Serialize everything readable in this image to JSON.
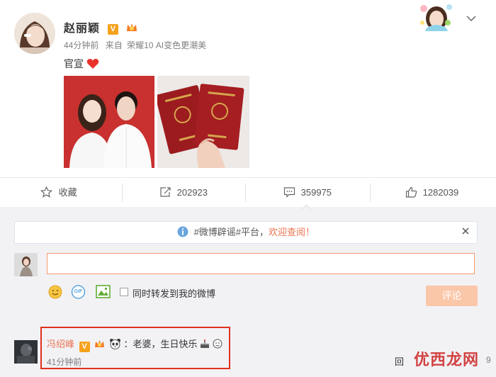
{
  "post": {
    "author": "赵丽颖",
    "time": "44分钟前",
    "source_prefix": "来自",
    "source": "荣耀10 AI变色更潮美",
    "text": "官宣",
    "vip_mark": "V"
  },
  "actions": {
    "favorite_label": "收藏",
    "repost_count": "202923",
    "comment_count": "359975",
    "like_count": "1282039"
  },
  "notice": {
    "topic": "#微博辟谣#平台，",
    "link": "欢迎查阅！"
  },
  "composer": {
    "input_value": "",
    "repost_checkbox_label": "同时转发到我的微博",
    "submit_label": "评论",
    "gif_label": "GIF"
  },
  "comment": {
    "author": "冯绍峰",
    "separator": "：",
    "text": "老婆，生日快乐",
    "time": "41分钟前",
    "vip_mark": "V"
  },
  "corner": {
    "reply_label": "回",
    "watermark": "优西龙网",
    "cut_text": "9"
  },
  "colors": {
    "accent_orange": "#eb7350",
    "vip_orange": "#f6a21c",
    "link_blue": "#eb7350",
    "highlight_red": "#e0301e"
  }
}
